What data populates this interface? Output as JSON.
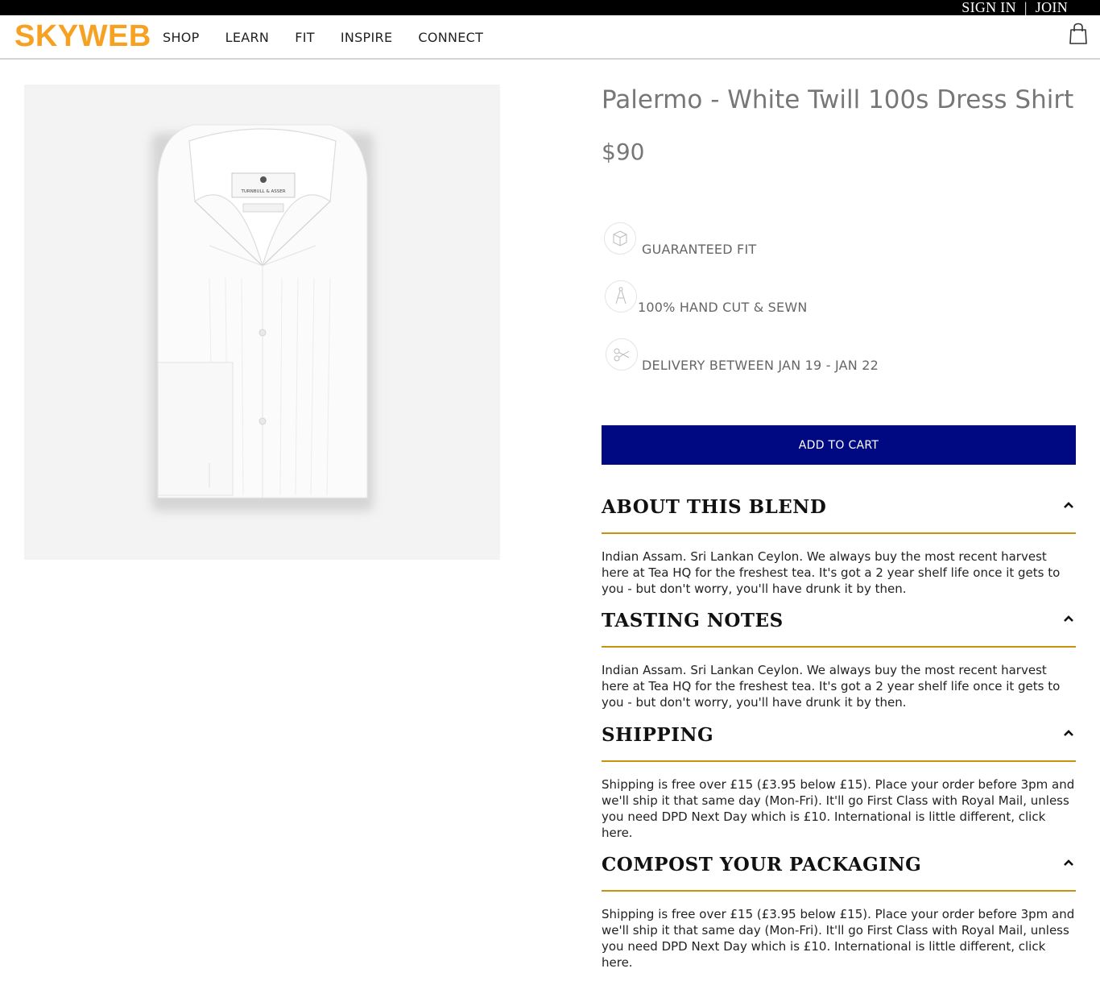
{
  "top_bar": {
    "sign_in": "SIGN IN",
    "separator": "|",
    "join": "JOIN"
  },
  "header": {
    "logo": "SKYWEB",
    "nav": [
      "SHOP",
      "LEARN",
      "FIT",
      "INSPIRE",
      "CONNECT"
    ],
    "cart_icon": "shopping-bag-icon"
  },
  "product": {
    "image_label": "TURNBULL & ASSER",
    "title": "Palermo - White Twill 100s Dress Shirt",
    "price": "$90",
    "features": [
      {
        "icon": "box-icon",
        "label": "GUARANTEED FIT"
      },
      {
        "icon": "compass-icon",
        "label": "100% HAND CUT & SEWN"
      },
      {
        "icon": "scissors-icon",
        "label": "DELIVERY BETWEEN JAN 19 - JAN 22"
      }
    ],
    "add_to_cart": "ADD TO CART"
  },
  "sections": [
    {
      "title": "ABOUT THIS BLEND",
      "body": "Indian Assam. Sri Lankan Ceylon. We always buy the most recent harvest here at Tea HQ for the freshest tea. It's got a 2 year shelf life once it gets to you - but don't worry, you'll have drunk it by then."
    },
    {
      "title": "TASTING NOTES",
      "body": "Indian Assam. Sri Lankan Ceylon. We always buy the most recent harvest here at Tea HQ for the freshest tea. It's got a 2 year shelf life once it gets to you - but don't worry, you'll have drunk it by then."
    },
    {
      "title": "SHIPPING",
      "body": "Shipping is free over £15 (£3.95 below £15). Place your order before 3pm and we'll ship it that same day (Mon-Fri). It'll go First Class with Royal Mail, unless you need DPD Next Day which is £10. International is little different, click here."
    },
    {
      "title": "COMPOST YOUR PACKAGING",
      "body": "Shipping is free over £15 (£3.95 below £15). Place your order before 3pm and we'll ship it that same day (Mon-Fri). It'll go First Class with Royal Mail, unless you need DPD Next Day which is £10. International is little different, click here."
    }
  ],
  "colors": {
    "logo": "#f7a122",
    "cta": "#000882",
    "divider": "#c8920e",
    "top_bar": "#000000"
  }
}
